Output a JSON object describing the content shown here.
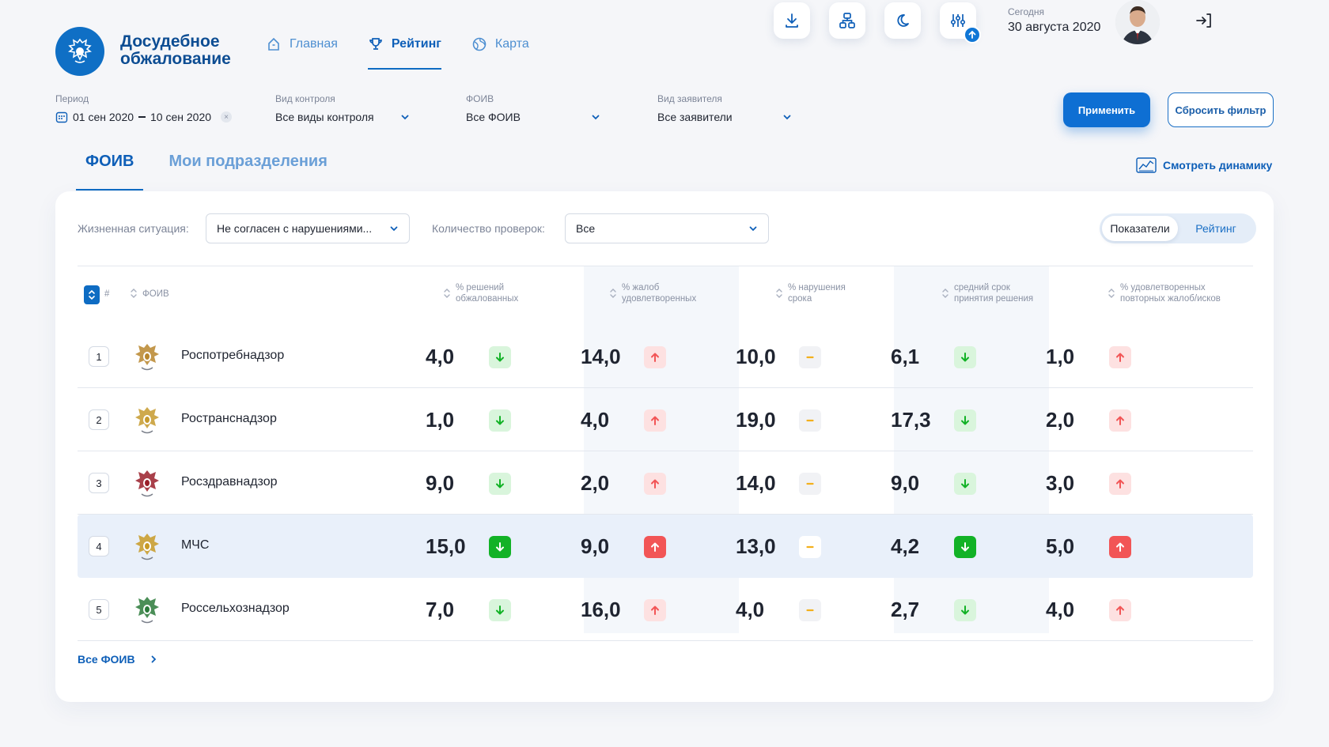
{
  "brand": {
    "line1": "Досудебное",
    "line2": "обжалование"
  },
  "nav": [
    {
      "label": "Главная",
      "icon": "home-icon",
      "active": false
    },
    {
      "label": "Рейтинг",
      "icon": "trophy-icon",
      "active": true
    },
    {
      "label": "Карта",
      "icon": "globe-icon",
      "active": false
    }
  ],
  "tools": [
    "download-icon",
    "org-structure-icon",
    "moon-icon",
    "settings-sliders-icon"
  ],
  "today": {
    "label": "Сегодня",
    "value": "30 августа 2020"
  },
  "filters": {
    "period": {
      "label": "Период",
      "from": "01 сен 2020",
      "to": "10 сен 2020"
    },
    "control": {
      "label": "Вид контроля",
      "value": "Все виды контроля"
    },
    "foiv": {
      "label": "ФОИВ",
      "value": "Все ФОИВ"
    },
    "applicant": {
      "label": "Вид заявителя",
      "value": "Все заявители"
    },
    "apply": "Применить",
    "reset": "Сбросить фильтр"
  },
  "tabs": [
    "ФОИВ",
    "Мои подразделения"
  ],
  "dynamics_link": "Смотреть динамику",
  "card": {
    "life_label": "Жизненная ситуация:",
    "life_value": "Не согласен с нарушениями...",
    "checks_label": "Количество проверок:",
    "checks_value": "Все",
    "toggle": [
      "Показатели",
      "Рейтинг"
    ],
    "all_link": "Все ФОИВ"
  },
  "table": {
    "headers": {
      "rank": "#",
      "name": "ФОИВ",
      "m1": [
        "% решений",
        "обжалованных"
      ],
      "m2": [
        "% жалоб",
        "удовлетворенных"
      ],
      "m3": [
        "% нарушения",
        "срока"
      ],
      "m4": [
        "средний срок",
        "принятия решения"
      ],
      "m5": [
        "% удовлетворенных",
        "повторных жалоб/исков"
      ]
    },
    "rows": [
      {
        "rank": "1",
        "name": "Роспотребнадзор",
        "v": [
          "4,0",
          "14,0",
          "10,0",
          "6,1",
          "1,0"
        ]
      },
      {
        "rank": "2",
        "name": "Ространснадзор",
        "v": [
          "1,0",
          "4,0",
          "19,0",
          "17,3",
          "2,0"
        ]
      },
      {
        "rank": "3",
        "name": "Росздравнадзор",
        "v": [
          "9,0",
          "2,0",
          "14,0",
          "9,0",
          "3,0"
        ]
      },
      {
        "rank": "4",
        "name": "МЧС",
        "v": [
          "15,0",
          "9,0",
          "13,0",
          "4,2",
          "5,0"
        ]
      },
      {
        "rank": "5",
        "name": "Россельхознадзор",
        "v": [
          "7,0",
          "16,0",
          "4,0",
          "2,7",
          "4,0"
        ]
      }
    ],
    "trends": [
      "down",
      "up",
      "flat",
      "down",
      "up"
    ]
  },
  "colors": {
    "accent": "#0e6cc3",
    "down": "#12b226",
    "up": "#f25556",
    "flat": "#f3b01c"
  }
}
